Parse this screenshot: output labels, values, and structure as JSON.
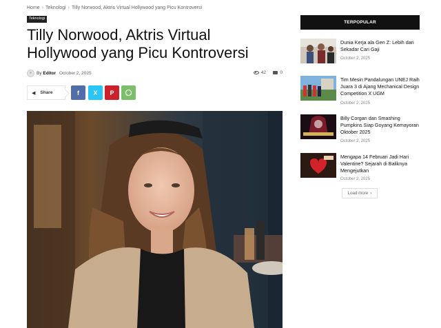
{
  "breadcrumb": {
    "home": "Home",
    "sep": "›",
    "category": "Teknologi",
    "current": "Tilly Norwood, Aktris Virtual Hollywood yang Picu Kontroversi"
  },
  "article": {
    "category_badge": "Teknologi",
    "title": "Tilly Norwood, Aktris Virtual Hollywood yang Picu Kontroversi",
    "by_prefix": "By",
    "author": "Editor",
    "date": "October 2, 2025",
    "views": "42",
    "comments": "0"
  },
  "share": {
    "label": "Share",
    "buttons": {
      "facebook": "f",
      "x": "X",
      "pinterest": "P",
      "whatsapp": "W"
    }
  },
  "sidebar": {
    "heading": "TERPOPULAR",
    "posts": [
      {
        "title": "Dunia Kerja ala Gen Z: Lebih dari Sekadar Cari Gaji",
        "date": "October 2, 2025"
      },
      {
        "title": "Tim Mesin Pandalungan UNEJ Raih Juara 3 di Ajang Mechanical Design Competition X UGM",
        "date": "October 2, 2025"
      },
      {
        "title": "Billy Corgan dan Smashing Pumpkins Siap Goyang Kemayoran Oktober 2025",
        "date": "October 2, 2025"
      },
      {
        "title": "Mengapa 14 Februari Jadi Hari Valentine? Sejarah di Baliknya Mengejutkan",
        "date": "October 2, 2025"
      }
    ],
    "load_more": "Load more",
    "load_more_arrow": "›"
  },
  "colors": {
    "facebook": "#516eab",
    "x": "#29c5f6",
    "pinterest": "#ca212a",
    "whatsapp": "#7bbf6a",
    "header_bar": "#111111"
  }
}
